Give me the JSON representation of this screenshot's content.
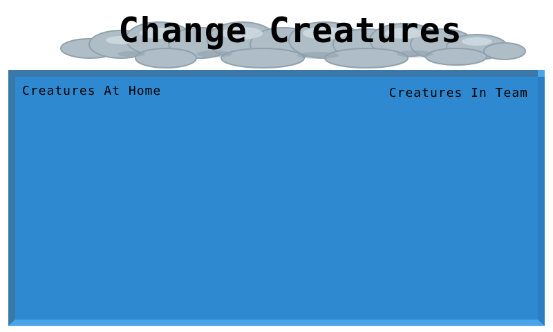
{
  "screen": {
    "title": "Change Creatures"
  },
  "panel": {
    "home_heading": "Creatures At Home",
    "team_heading": "Creatures In Team",
    "home_creatures": [],
    "team_creatures": []
  },
  "colors": {
    "panel_fill": "#2e89d1",
    "panel_border_dark": "#3a78aa",
    "panel_border_light": "#4aa4ea",
    "cloud": "#b9c7cf",
    "background": "#ffffff"
  },
  "icons": {
    "title_backdrop": "cloud-icon"
  }
}
